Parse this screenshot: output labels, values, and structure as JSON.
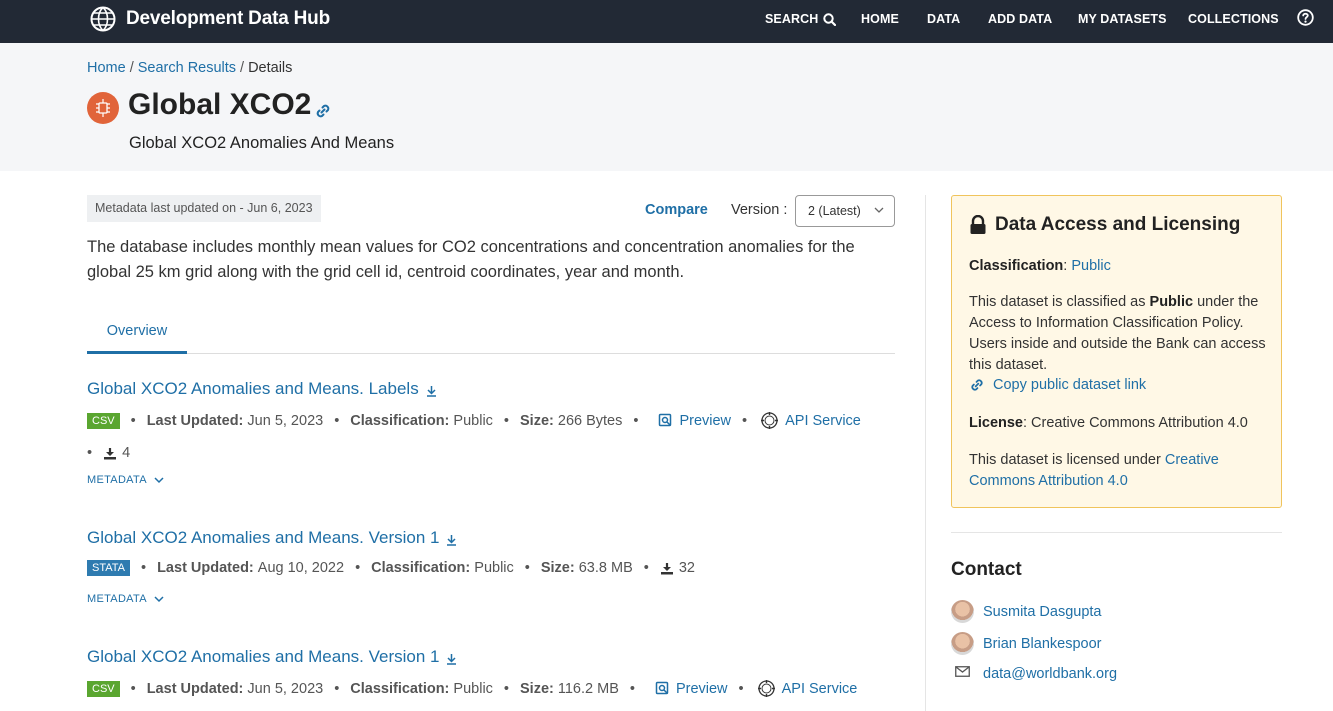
{
  "nav": {
    "brand": "Development Data Hub",
    "search": "SEARCH",
    "home": "HOME",
    "data": "DATA",
    "add_data": "ADD DATA",
    "my_datasets": "MY DATASETS",
    "collections": "COLLECTIONS"
  },
  "breadcrumb": {
    "home": "Home",
    "sep1": "/",
    "search_results": "Search Results",
    "sep2": "/",
    "current": "Details"
  },
  "dataset": {
    "title": "Global XCO2",
    "subtitle": "Global XCO2 Anomalies And Means",
    "metadata_updated": "Metadata last updated on - Jun 6, 2023",
    "compare": "Compare",
    "version_label": "Version :",
    "version_value": "2 (Latest)",
    "description": "The database includes monthly mean values for CO2 concentrations and concentration anomalies for the global 25 km grid along with the grid cell id, centroid coordinates, year and month."
  },
  "tabs": {
    "overview": "Overview"
  },
  "resources": [
    {
      "title": "Global XCO2 Anomalies and Means. Labels",
      "format": "CSV",
      "last_updated_label": "Last Updated:",
      "last_updated": "Jun 5, 2023",
      "classification_label": "Classification:",
      "classification": "Public",
      "size_label": "Size:",
      "size": "266 Bytes",
      "preview": "Preview",
      "api": "API Service",
      "downloads": "4",
      "metadata": "METADATA"
    },
    {
      "title": "Global XCO2 Anomalies and Means. Version 1",
      "format": "STATA",
      "last_updated_label": "Last Updated:",
      "last_updated": "Aug 10, 2022",
      "classification_label": "Classification:",
      "classification": "Public",
      "size_label": "Size:",
      "size": "63.8 MB",
      "downloads": "32",
      "metadata": "METADATA"
    },
    {
      "title": "Global XCO2 Anomalies and Means. Version 1",
      "format": "CSV",
      "last_updated_label": "Last Updated:",
      "last_updated": "Jun 5, 2023",
      "classification_label": "Classification:",
      "classification": "Public",
      "size_label": "Size:",
      "size": "116.2 MB",
      "preview": "Preview",
      "api": "API Service"
    }
  ],
  "access": {
    "title": "Data Access and Licensing",
    "classification_label": "Classification",
    "classification_value": "Public",
    "classified_pre": "This dataset is classified as ",
    "classified_bold": "Public",
    "classified_post": " under the Access to Information Classification Policy. Users inside and outside the Bank can access this dataset.",
    "copy_link": "Copy public dataset link",
    "license_label": "License",
    "license_value": ": Creative Commons Attribution 4.0",
    "licensed_pre": "This dataset is licensed under ",
    "licensed_link": "Creative Commons Attribution 4.0"
  },
  "contact": {
    "title": "Contact",
    "person1": "Susmita Dasgupta",
    "person2": "Brian Blankespoor",
    "email": "data@worldbank.org"
  },
  "colors": {
    "nav_bg": "#222935",
    "link": "#1f6fa6",
    "csv_badge": "#5aa630",
    "stata_badge": "#2e7bb0",
    "dataset_icon": "#e1643a",
    "access_bg": "#fff8e6",
    "access_border": "#f0c45c"
  }
}
